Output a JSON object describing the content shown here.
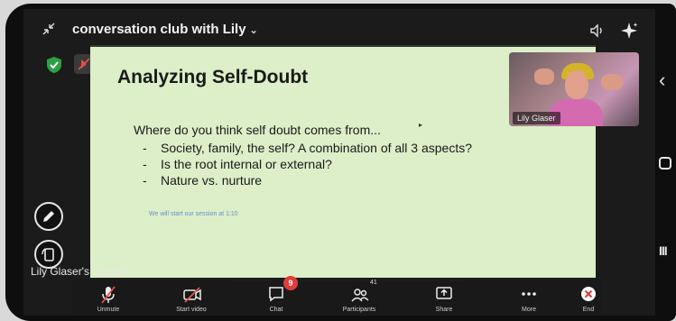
{
  "meeting": {
    "title": "conversation club with Lily",
    "title_chevron": "⌄"
  },
  "slide": {
    "title": "Analyzing Self-Doubt",
    "question": "Where do you think self doubt comes from...",
    "bullets": [
      "Society, family, the self? A combination of all 3 aspects?",
      "Is the root internal or external?",
      "Nature vs. nurture"
    ],
    "note": "We will start our session at 1:10"
  },
  "participant_video": {
    "name": "Lily Glaser"
  },
  "screen_share_label": "Lily Glaser's screen",
  "toolbar": {
    "unmute": "Unmute",
    "start_video": "Start video",
    "chat": "Chat",
    "chat_badge": "9",
    "participants": "Participants",
    "participants_count": "41",
    "share": "Share",
    "more": "More",
    "end": "End"
  },
  "colors": {
    "slide_bg": "#dcefc8",
    "badge_red": "#e23a3a",
    "shield_green": "#2ea043",
    "end_red": "#d93a3a"
  }
}
